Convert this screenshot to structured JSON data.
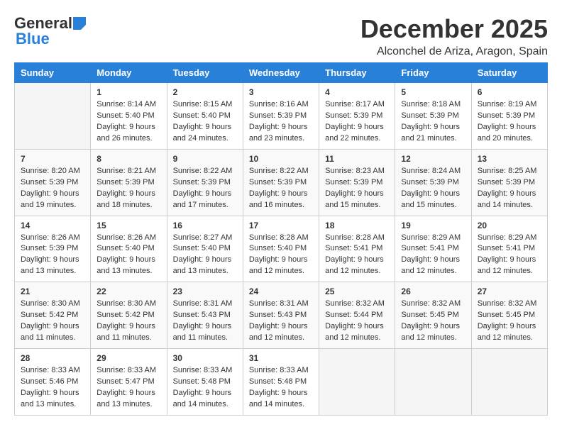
{
  "logo": {
    "general": "General",
    "blue": "Blue"
  },
  "title": {
    "month": "December 2025",
    "location": "Alconchel de Ariza, Aragon, Spain"
  },
  "days_of_week": [
    "Sunday",
    "Monday",
    "Tuesday",
    "Wednesday",
    "Thursday",
    "Friday",
    "Saturday"
  ],
  "weeks": [
    [
      {
        "day": "",
        "info": ""
      },
      {
        "day": "1",
        "info": "Sunrise: 8:14 AM\nSunset: 5:40 PM\nDaylight: 9 hours\nand 26 minutes."
      },
      {
        "day": "2",
        "info": "Sunrise: 8:15 AM\nSunset: 5:40 PM\nDaylight: 9 hours\nand 24 minutes."
      },
      {
        "day": "3",
        "info": "Sunrise: 8:16 AM\nSunset: 5:39 PM\nDaylight: 9 hours\nand 23 minutes."
      },
      {
        "day": "4",
        "info": "Sunrise: 8:17 AM\nSunset: 5:39 PM\nDaylight: 9 hours\nand 22 minutes."
      },
      {
        "day": "5",
        "info": "Sunrise: 8:18 AM\nSunset: 5:39 PM\nDaylight: 9 hours\nand 21 minutes."
      },
      {
        "day": "6",
        "info": "Sunrise: 8:19 AM\nSunset: 5:39 PM\nDaylight: 9 hours\nand 20 minutes."
      }
    ],
    [
      {
        "day": "7",
        "info": "Sunrise: 8:20 AM\nSunset: 5:39 PM\nDaylight: 9 hours\nand 19 minutes."
      },
      {
        "day": "8",
        "info": "Sunrise: 8:21 AM\nSunset: 5:39 PM\nDaylight: 9 hours\nand 18 minutes."
      },
      {
        "day": "9",
        "info": "Sunrise: 8:22 AM\nSunset: 5:39 PM\nDaylight: 9 hours\nand 17 minutes."
      },
      {
        "day": "10",
        "info": "Sunrise: 8:22 AM\nSunset: 5:39 PM\nDaylight: 9 hours\nand 16 minutes."
      },
      {
        "day": "11",
        "info": "Sunrise: 8:23 AM\nSunset: 5:39 PM\nDaylight: 9 hours\nand 15 minutes."
      },
      {
        "day": "12",
        "info": "Sunrise: 8:24 AM\nSunset: 5:39 PM\nDaylight: 9 hours\nand 15 minutes."
      },
      {
        "day": "13",
        "info": "Sunrise: 8:25 AM\nSunset: 5:39 PM\nDaylight: 9 hours\nand 14 minutes."
      }
    ],
    [
      {
        "day": "14",
        "info": "Sunrise: 8:26 AM\nSunset: 5:39 PM\nDaylight: 9 hours\nand 13 minutes."
      },
      {
        "day": "15",
        "info": "Sunrise: 8:26 AM\nSunset: 5:40 PM\nDaylight: 9 hours\nand 13 minutes."
      },
      {
        "day": "16",
        "info": "Sunrise: 8:27 AM\nSunset: 5:40 PM\nDaylight: 9 hours\nand 13 minutes."
      },
      {
        "day": "17",
        "info": "Sunrise: 8:28 AM\nSunset: 5:40 PM\nDaylight: 9 hours\nand 12 minutes."
      },
      {
        "day": "18",
        "info": "Sunrise: 8:28 AM\nSunset: 5:41 PM\nDaylight: 9 hours\nand 12 minutes."
      },
      {
        "day": "19",
        "info": "Sunrise: 8:29 AM\nSunset: 5:41 PM\nDaylight: 9 hours\nand 12 minutes."
      },
      {
        "day": "20",
        "info": "Sunrise: 8:29 AM\nSunset: 5:41 PM\nDaylight: 9 hours\nand 12 minutes."
      }
    ],
    [
      {
        "day": "21",
        "info": "Sunrise: 8:30 AM\nSunset: 5:42 PM\nDaylight: 9 hours\nand 11 minutes."
      },
      {
        "day": "22",
        "info": "Sunrise: 8:30 AM\nSunset: 5:42 PM\nDaylight: 9 hours\nand 11 minutes."
      },
      {
        "day": "23",
        "info": "Sunrise: 8:31 AM\nSunset: 5:43 PM\nDaylight: 9 hours\nand 11 minutes."
      },
      {
        "day": "24",
        "info": "Sunrise: 8:31 AM\nSunset: 5:43 PM\nDaylight: 9 hours\nand 12 minutes."
      },
      {
        "day": "25",
        "info": "Sunrise: 8:32 AM\nSunset: 5:44 PM\nDaylight: 9 hours\nand 12 minutes."
      },
      {
        "day": "26",
        "info": "Sunrise: 8:32 AM\nSunset: 5:45 PM\nDaylight: 9 hours\nand 12 minutes."
      },
      {
        "day": "27",
        "info": "Sunrise: 8:32 AM\nSunset: 5:45 PM\nDaylight: 9 hours\nand 12 minutes."
      }
    ],
    [
      {
        "day": "28",
        "info": "Sunrise: 8:33 AM\nSunset: 5:46 PM\nDaylight: 9 hours\nand 13 minutes."
      },
      {
        "day": "29",
        "info": "Sunrise: 8:33 AM\nSunset: 5:47 PM\nDaylight: 9 hours\nand 13 minutes."
      },
      {
        "day": "30",
        "info": "Sunrise: 8:33 AM\nSunset: 5:48 PM\nDaylight: 9 hours\nand 14 minutes."
      },
      {
        "day": "31",
        "info": "Sunrise: 8:33 AM\nSunset: 5:48 PM\nDaylight: 9 hours\nand 14 minutes."
      },
      {
        "day": "",
        "info": ""
      },
      {
        "day": "",
        "info": ""
      },
      {
        "day": "",
        "info": ""
      }
    ]
  ]
}
